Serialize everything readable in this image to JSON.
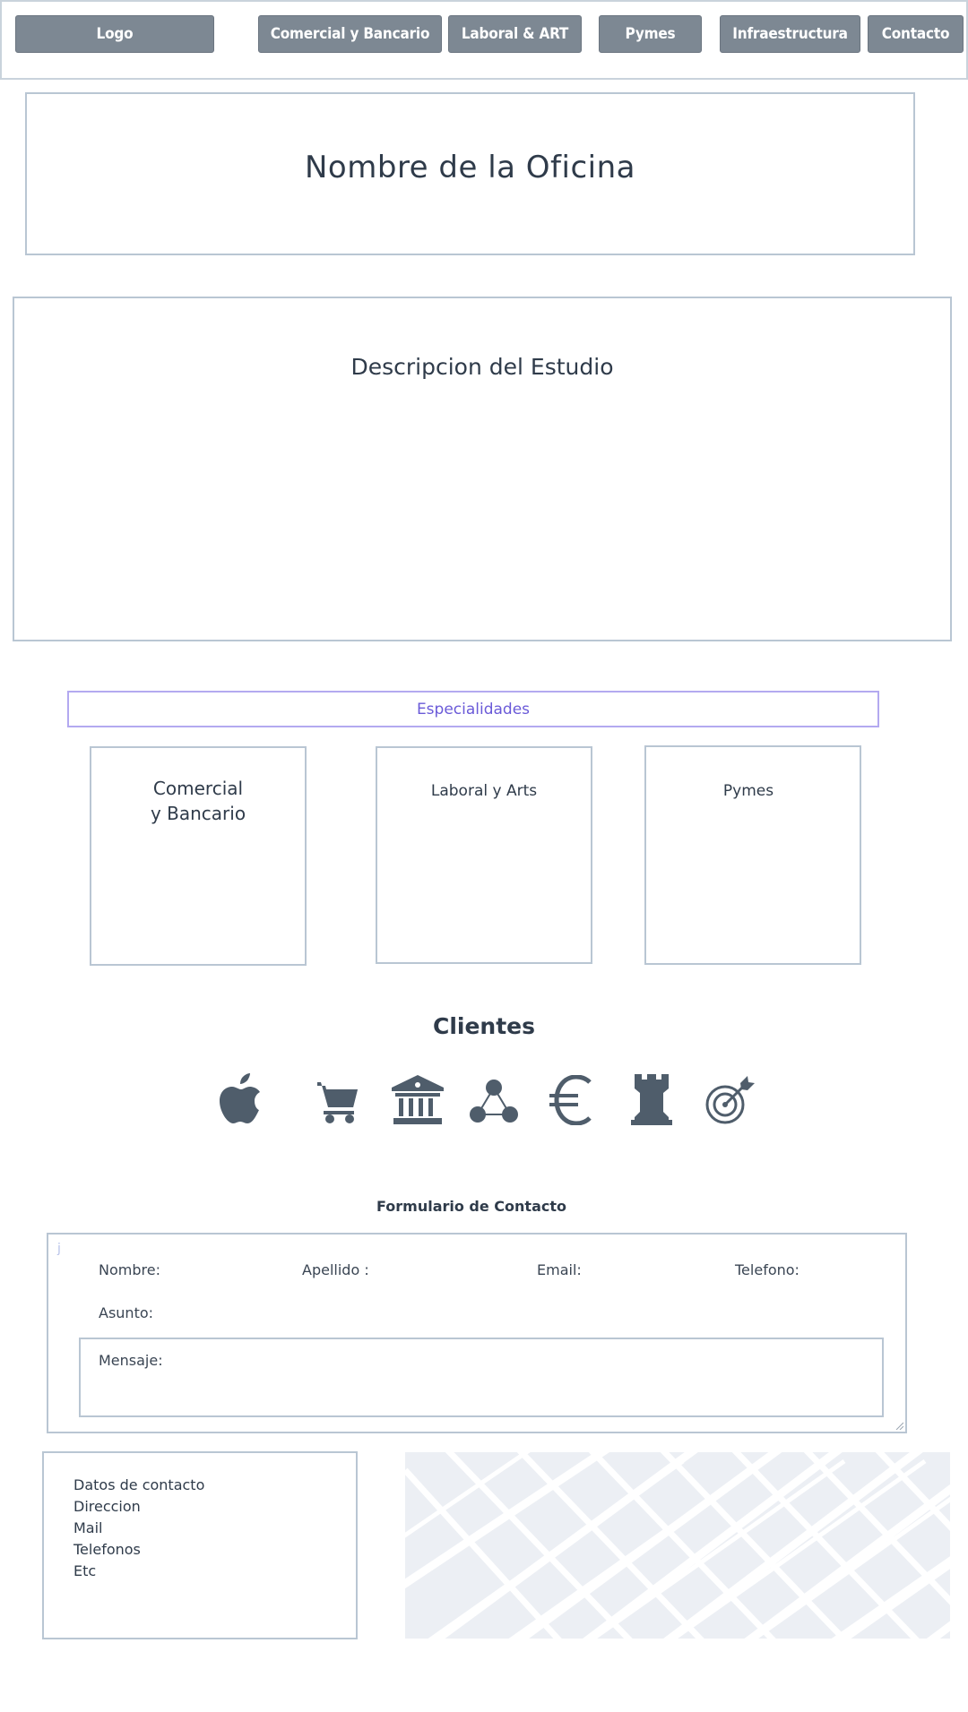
{
  "nav": {
    "logo": "Logo",
    "items": [
      "Comercial y Bancario",
      "Laboral & ART",
      "Pymes",
      "Infraestructura",
      "Contacto"
    ]
  },
  "office": {
    "title": "Nombre de la Oficina"
  },
  "description": {
    "title": "Descripcion del Estudio"
  },
  "specialties": {
    "header": "Especialidades",
    "cards": [
      {
        "line1": "Comercial",
        "line2": "y Bancario"
      },
      {
        "line1": "Laboral y Arts"
      },
      {
        "line1": "Pymes"
      }
    ]
  },
  "clients": {
    "title": "Clientes",
    "icons": [
      "apple-icon",
      "shopping-cart-icon",
      "bank-icon",
      "network-icon",
      "euro-icon",
      "chess-rook-icon",
      "target-icon"
    ]
  },
  "form": {
    "title": "Formulario de Contacto",
    "corner_mark": "j",
    "labels": {
      "nombre": "Nombre:",
      "apellido": "Apellido :",
      "email": "Email:",
      "telefono": "Telefono:",
      "asunto": "Asunto:",
      "mensaje": "Mensaje:"
    }
  },
  "contact": {
    "lines": [
      "Datos de contacto",
      "Direccion",
      "Mail",
      "Telefonos",
      "Etc"
    ]
  },
  "colors": {
    "nav_button": "#7d8893",
    "border": "#b9c6d3",
    "accent": "#6a5ad8",
    "icon": "#4f5d6b",
    "map_bg": "#eceff4"
  }
}
